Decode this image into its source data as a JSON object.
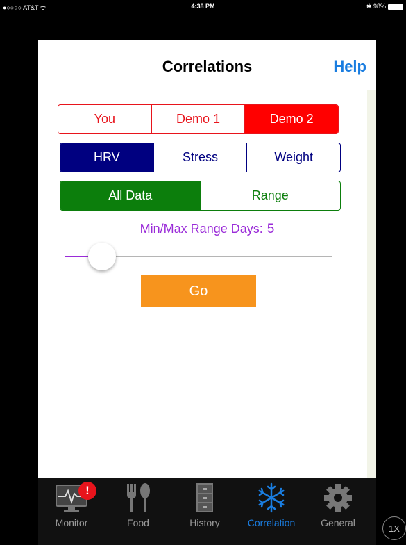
{
  "status_bar": {
    "carrier": "●○○○○ AT&T ᯤ",
    "time": "4:38 PM",
    "battery": "✱ 98%"
  },
  "header": {
    "title": "Correlations",
    "help_label": "Help"
  },
  "user_segment": {
    "options": [
      "You",
      "Demo 1",
      "Demo 2"
    ],
    "selected_index": 2
  },
  "metric_segment": {
    "options": [
      "HRV",
      "Stress",
      "Weight"
    ],
    "selected_index": 0
  },
  "data_segment": {
    "options": [
      "All Data",
      "Range"
    ],
    "selected_index": 0
  },
  "range": {
    "label": "Min/Max Range Days:",
    "value": "5",
    "slider_fraction": 0.14
  },
  "go_label": "Go",
  "tabs": [
    {
      "label": "Monitor",
      "icon": "monitor-icon",
      "badge": "!"
    },
    {
      "label": "Food",
      "icon": "fork-spoon-icon"
    },
    {
      "label": "History",
      "icon": "file-cabinet-icon"
    },
    {
      "label": "Correlation",
      "icon": "snowflake-icon",
      "active": true
    },
    {
      "label": "General",
      "icon": "gear-icon"
    }
  ],
  "zoom_label": "1X",
  "colors": {
    "accent_blue": "#1a7de0",
    "red": "#ff0000",
    "navy": "#000080",
    "green": "#0c7e0c",
    "purple": "#9a2bd8",
    "orange": "#f7941d"
  }
}
